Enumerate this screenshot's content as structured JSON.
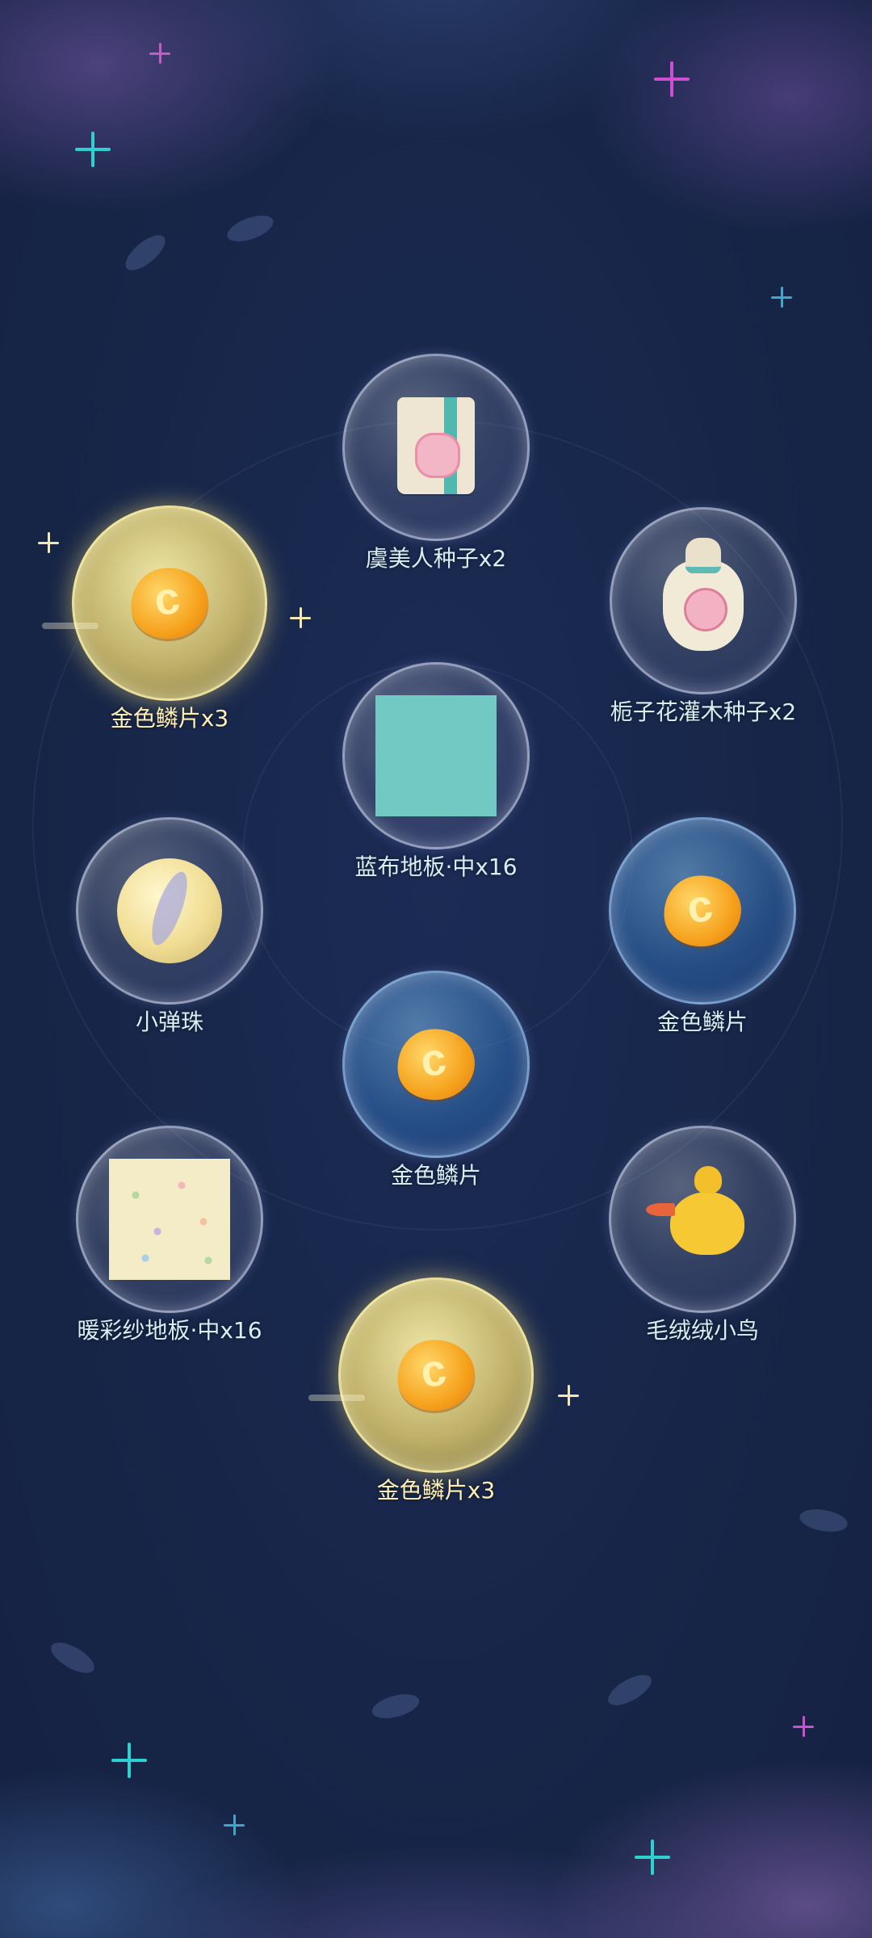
{
  "colors": {
    "background": "#172649",
    "label": "#d9eef3",
    "gold_label": "#fff0b8",
    "gold_bubble": "#e6d585",
    "blue_bubble": "#3b78c0"
  },
  "rewards": [
    {
      "label": "虞美人种子x2",
      "icon": "seed-packet-icon",
      "bubble": "clear"
    },
    {
      "label": "金色鳞片x3",
      "icon": "gold-scale-icon",
      "bubble": "gold"
    },
    {
      "label": "栀子花灌木种子x2",
      "icon": "seed-bag-icon",
      "bubble": "clear"
    },
    {
      "label": "蓝布地板·中x16",
      "icon": "blue-floor-tile-icon",
      "bubble": "clear"
    },
    {
      "label": "小弹珠",
      "icon": "marble-icon",
      "bubble": "clear"
    },
    {
      "label": "金色鳞片",
      "icon": "gold-scale-icon",
      "bubble": "blue"
    },
    {
      "label": "金色鳞片",
      "icon": "gold-scale-icon",
      "bubble": "blue"
    },
    {
      "label": "暖彩纱地板·中x16",
      "icon": "warm-floor-tile-icon",
      "bubble": "clear"
    },
    {
      "label": "毛绒绒小鸟",
      "icon": "plush-bird-icon",
      "bubble": "clear"
    },
    {
      "label": "金色鳞片x3",
      "icon": "gold-scale-icon",
      "bubble": "gold"
    }
  ]
}
